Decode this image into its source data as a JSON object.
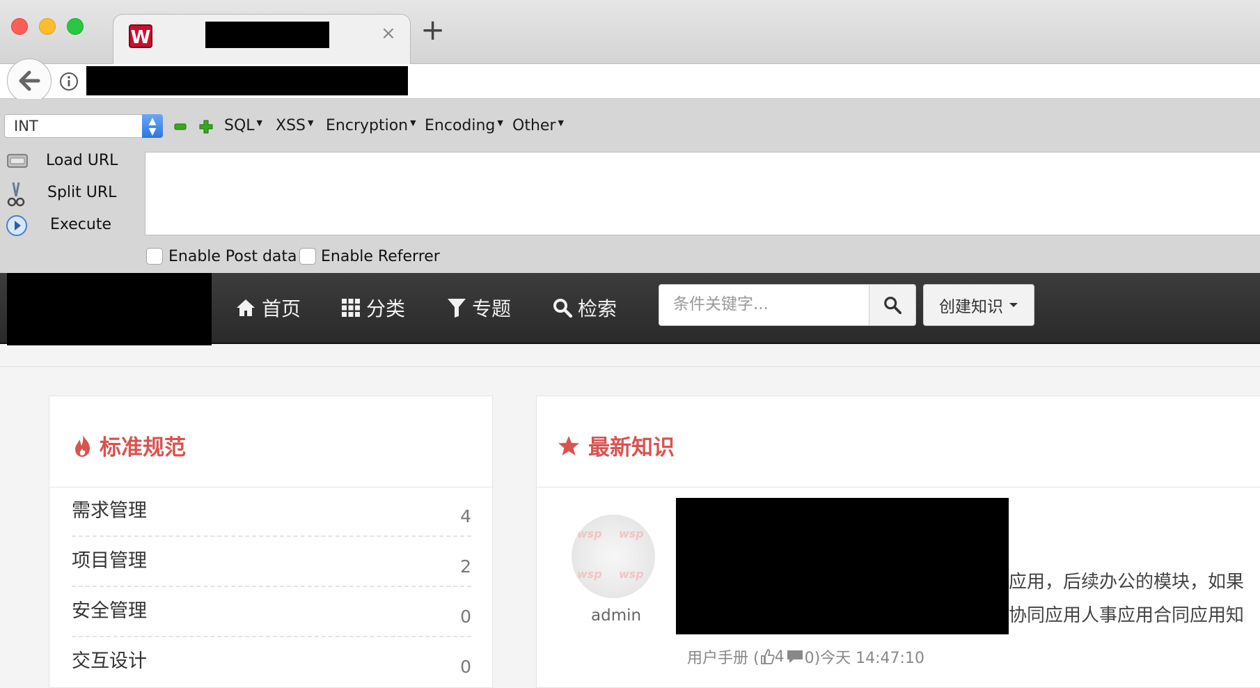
{
  "browser": {
    "new_tab_label": "+",
    "tab_close": "×"
  },
  "hackbar": {
    "type_select": "INT",
    "menus": [
      "SQL",
      "XSS",
      "Encryption",
      "Encoding",
      "Other"
    ],
    "actions": [
      "Load URL",
      "Split URL",
      "Execute"
    ],
    "checkboxes": [
      "Enable Post data",
      "Enable Referrer"
    ]
  },
  "nav": {
    "items": [
      "首页",
      "分类",
      "专题",
      "检索"
    ],
    "search_placeholder": "条件关键字...",
    "create_label": "创建知识"
  },
  "standards": {
    "title": "标准规范",
    "items": [
      {
        "name": "需求管理",
        "count": "4"
      },
      {
        "name": "项目管理",
        "count": "2"
      },
      {
        "name": "安全管理",
        "count": "0"
      },
      {
        "name": "交互设计",
        "count": "0"
      }
    ]
  },
  "latest": {
    "title": "最新知识",
    "author": "admin",
    "text_line1": "应用，后续办公的模块，如果",
    "text_line2": "协同应用人事应用合同应用知",
    "meta": "用户手册 (",
    "likes": "4",
    "comments": "0)今天 14:47:10"
  }
}
